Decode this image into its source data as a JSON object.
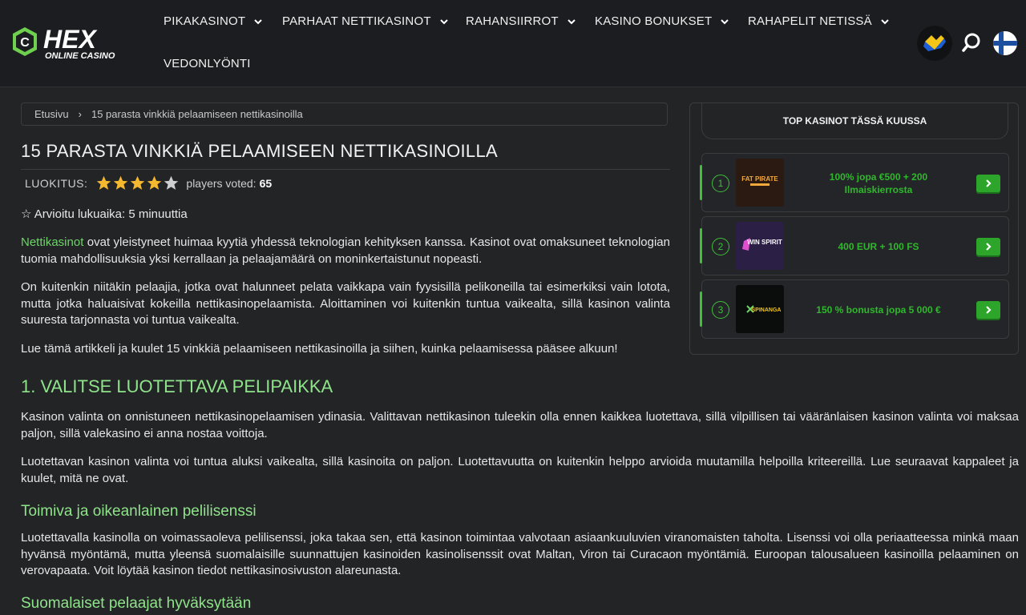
{
  "header": {
    "logo_text": "HEX",
    "logo_sub": "ONLINE CASINO",
    "nav": [
      {
        "label": "PIKAKASINOT"
      },
      {
        "label": "PARHAAT NETTIKASINOT"
      },
      {
        "label": "RAHANSIIRROT"
      },
      {
        "label": "KASINO BONUKSET"
      },
      {
        "label": "RAHAPELIT NETISSÄ"
      },
      {
        "label": "VEDONLYÖNTI"
      }
    ]
  },
  "breadcrumb": {
    "home": "Etusivu",
    "separator": "›",
    "current": "15 parasta vinkkiä pelaamiseen nettikasinoilla"
  },
  "article": {
    "title": "15 PARASTA VINKKIÄ PELAAMISEEN NETTIKASINOILLA",
    "rating_label": "LUOKITUS:",
    "rating_stars": 4,
    "rating_max": 5,
    "voted_label": "players voted:",
    "voted_count": "65",
    "read_time": "☆ Arvioitu lukuaika: 5 minuuttia",
    "p1_link": "Nettikasinot",
    "p1_rest": " ovat yleistyneet huimaa kyytiä yhdessä teknologian kehityksen kanssa. Kasinot ovat omaksuneet teknologian tuomia mahdollisuuksia yksi kerrallaan ja pelaajamäärä on moninkertaistunut nopeasti.",
    "p2": "On kuitenkin niitäkin pelaajia, jotka ovat halunneet pelata vaikkapa vain fyysisillä pelikoneilla tai esimerkiksi vain lotota, mutta jotka haluaisivat kokeilla nettikasinopelaamista. Aloittaminen voi kuitenkin tuntua vaikealta, sillä kasinon valinta suuresta tarjonnasta voi tuntua vaikealta.",
    "p3": "Lue tämä artikkeli ja kuulet 15 vinkkiä pelaamiseen nettikasinoilla ja siihen, kuinka pelaamisessa pääsee alkuun!",
    "h2_1": "1. VALITSE LUOTETTAVA PELIPAIKKA",
    "p4": "Kasinon valinta on onnistuneen nettikasinopelaamisen ydinasia. Valittavan nettikasinon tuleekin olla ennen kaikkea luotettava, sillä vilpillisen tai vääränlaisen kasinon valinta voi maksaa paljon, sillä valekasino ei anna nostaa voittoja.",
    "p5": "Luotettavan kasinon valinta voi tuntua aluksi vaikealta, sillä kasinoita on paljon. Luotettavuutta on kuitenkin helppo arvioida muutamilla helpoilla kriteereillä. Lue seuraavat kappaleet ja kuulet, mitä ne ovat.",
    "h3_1": "Toimiva ja oikeanlainen pelilisenssi",
    "p6": "Luotettavalla kasinolla on voimassaoleva pelilisenssi, joka takaa sen, että kasinon toimintaa valvotaan asiaankuuluvien viranomaisten taholta. Lisenssi voi olla periaatteessa minkä maan hyvänsä myöntämä, mutta yleensä suomalaisille suunnattujen kasinoiden kasinolisenssit ovat Maltan, Viron tai Curacaon myöntämiä. Euroopan talousalueen kasinoilla pelaaminen on verovapaata. Voit löytää kasinon tiedot nettikasinosivuston alareunasta.",
    "h3_2": "Suomalaiset pelaajat hyväksytään"
  },
  "sidebar": {
    "title": "TOP KASINOT TÄSSÄ KUUSSA",
    "casinos": [
      {
        "rank": "1",
        "logo": "FAT PIRATE",
        "bonus": "100% jopa €500 + 200 Ilmaiskierrosta"
      },
      {
        "rank": "2",
        "logo": "WIN SPIRIT",
        "bonus": "400 EUR + 100 FS"
      },
      {
        "rank": "3",
        "logo": "SPINANGA",
        "bonus": "150 % bonusta jopa 5 000 €"
      }
    ]
  },
  "colors": {
    "accent": "#8fe38a",
    "button": "#2ca52a",
    "background": "#232426",
    "header": "#1b1d20"
  }
}
